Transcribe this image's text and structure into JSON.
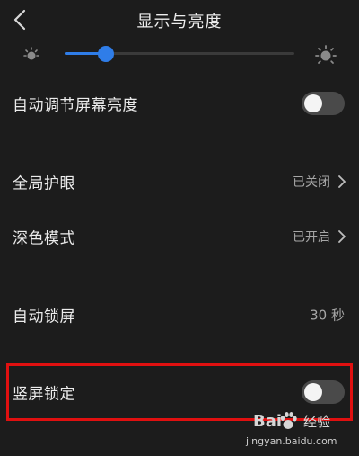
{
  "header": {
    "title": "显示与亮度"
  },
  "brightness": {
    "level_percent": 18
  },
  "rows": [
    {
      "key": "auto_brightness",
      "label": "自动调节屏幕亮度",
      "type": "toggle",
      "on": false
    },
    {
      "key": "eye_protection",
      "label": "全局护眼",
      "type": "link",
      "value": "已关闭"
    },
    {
      "key": "dark_mode",
      "label": "深色模式",
      "type": "link",
      "value": "已开启"
    },
    {
      "key": "auto_lock",
      "label": "自动锁屏",
      "type": "value",
      "value": "30 秒"
    },
    {
      "key": "portrait_lock",
      "label": "竖屏锁定",
      "type": "toggle",
      "on": false
    }
  ],
  "watermark": {
    "logo": "Bai",
    "logo_suffix": "经验",
    "url": "jingyan.baidu.com"
  },
  "colors": {
    "background": "#1c1c1c",
    "accent": "#2f7de8",
    "highlight": "#e01010"
  },
  "icons": {
    "back": "chevron-left-icon",
    "brightness_low": "sun-small-icon",
    "brightness_high": "sun-large-icon",
    "chevron": "chevron-right-icon"
  }
}
